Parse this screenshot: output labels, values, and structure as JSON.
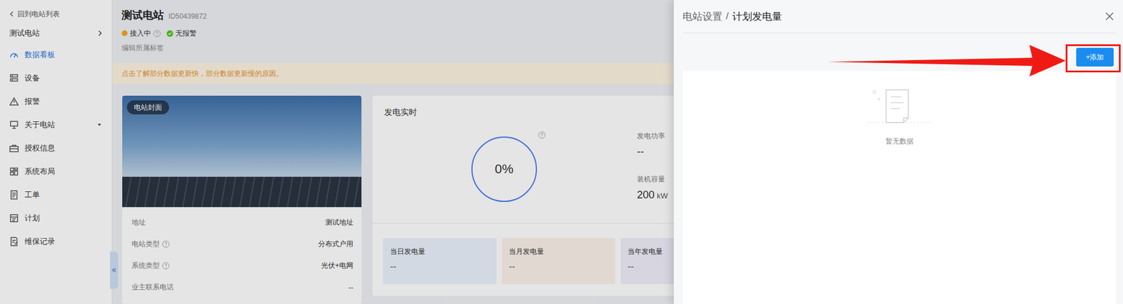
{
  "sidebar": {
    "back": "回到电站列表",
    "station": "测试电站",
    "items": [
      {
        "label": "数据看板",
        "selected": true,
        "kind": "link"
      },
      {
        "label": "设备",
        "selected": false,
        "kind": "link"
      },
      {
        "label": "报警",
        "selected": false,
        "kind": "link"
      },
      {
        "label": "关于电站",
        "selected": false,
        "kind": "group"
      },
      {
        "label": "授权信息",
        "selected": false,
        "kind": "link"
      },
      {
        "label": "系统布局",
        "selected": false,
        "kind": "link"
      },
      {
        "label": "工单",
        "selected": false,
        "kind": "link"
      },
      {
        "label": "计划",
        "selected": false,
        "kind": "link"
      },
      {
        "label": "维保记录",
        "selected": false,
        "kind": "link"
      }
    ]
  },
  "station": {
    "name": "测试电站",
    "id": "ID50439872",
    "statuses": [
      {
        "label": "接入中",
        "kind": "dot",
        "color": "#f5a623",
        "help": true
      },
      {
        "label": "无报警",
        "kind": "check",
        "color": "#52c41a",
        "help": false
      }
    ],
    "edit_tags": "编辑所属标签"
  },
  "notice": "点击了解部分数据更新快，部分数据更新慢的原因。",
  "cover": {
    "tag": "电站封面"
  },
  "info": [
    {
      "label": "地址",
      "value": "测试地址",
      "help": false
    },
    {
      "label": "电站类型",
      "value": "分布式户用",
      "help": true
    },
    {
      "label": "系统类型",
      "value": "光伏+电网",
      "help": true
    },
    {
      "label": "业主联系电话",
      "value": "--",
      "help": false
    }
  ],
  "realtime": {
    "title": "发电实时",
    "gauge": {
      "reading": "0%",
      "level": 0,
      "help": true
    },
    "metrics": [
      {
        "label": "发电功率",
        "value": "--",
        "unit": ""
      },
      {
        "label": "装机容量",
        "value": "200",
        "unit": "kW"
      }
    ]
  },
  "stats": [
    {
      "label": "当日发电量",
      "value": "--",
      "color": "#eaf2fc"
    },
    {
      "label": "当月发电量",
      "value": "--",
      "color": "#fcf1ea"
    },
    {
      "label": "当年发电量",
      "value": "--",
      "color": "#efeefa"
    }
  ],
  "drawer": {
    "breadcrumb": [
      {
        "label": "电站设置",
        "current": false
      },
      {
        "label": "计划发电量",
        "current": true
      }
    ],
    "separator": "/",
    "add_button": "+添加",
    "empty": "暂无数据"
  }
}
